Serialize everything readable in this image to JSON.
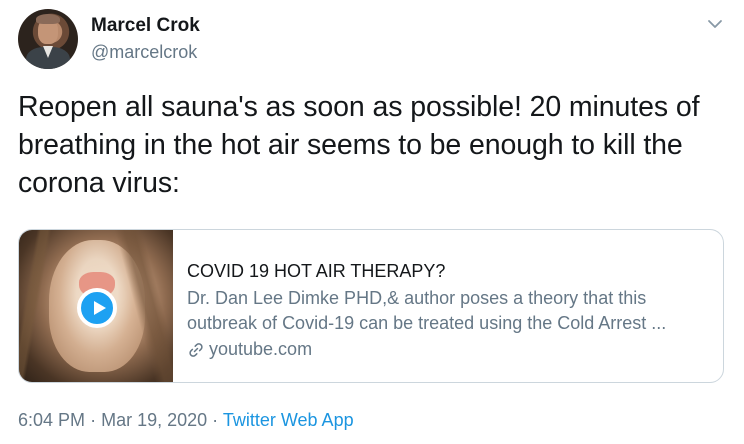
{
  "author": {
    "display_name": "Marcel Crok",
    "handle": "@marcelcrok"
  },
  "tweet": {
    "lines": [
      "Reopen all sauna's as soon as possible! 20 minutes of",
      "breathing in the hot air seems to be enough to kill the",
      "corona virus:"
    ]
  },
  "card": {
    "title": "COVID 19 HOT AIR THERAPY?",
    "description_lines": [
      "Dr. Dan Lee Dimke PHD,& author poses a theory that this",
      "outbreak of Covid-19 can be treated using the Cold Arrest ..."
    ],
    "domain": "youtube.com",
    "accent_color": "#1da1f2"
  },
  "meta": {
    "time": "6:04 PM",
    "separator": "·",
    "date": "Mar 19, 2020",
    "source": "Twitter Web App",
    "source_color": "#1b95e0"
  },
  "icons": {
    "caret": "chevron-down-icon",
    "play": "play-icon",
    "link": "link-icon"
  }
}
